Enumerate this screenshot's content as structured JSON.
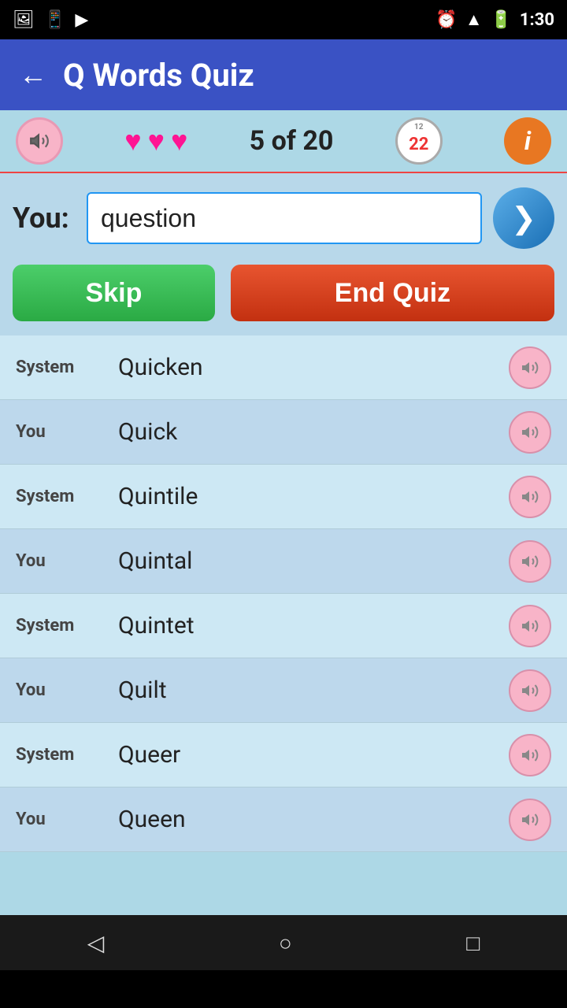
{
  "statusBar": {
    "time": "1:30"
  },
  "header": {
    "backLabel": "←",
    "title": "Q Words Quiz"
  },
  "controls": {
    "soundLabel": "🔊",
    "hearts": [
      "♥",
      "♥",
      "♥"
    ],
    "progress": "5 of 20",
    "timerValue": "22",
    "infoLabel": "i"
  },
  "inputArea": {
    "youLabel": "You:",
    "inputValue": "question",
    "inputPlaceholder": "",
    "nextBtnLabel": "❯"
  },
  "buttons": {
    "skipLabel": "Skip",
    "endQuizLabel": "End Quiz"
  },
  "wordList": [
    {
      "speaker": "System",
      "word": "Quicken"
    },
    {
      "speaker": "You",
      "word": "Quick"
    },
    {
      "speaker": "System",
      "word": "Quintile"
    },
    {
      "speaker": "You",
      "word": "Quintal"
    },
    {
      "speaker": "System",
      "word": "Quintet"
    },
    {
      "speaker": "You",
      "word": "Quilt"
    },
    {
      "speaker": "System",
      "word": "Queer"
    },
    {
      "speaker": "You",
      "word": "Queen"
    }
  ]
}
